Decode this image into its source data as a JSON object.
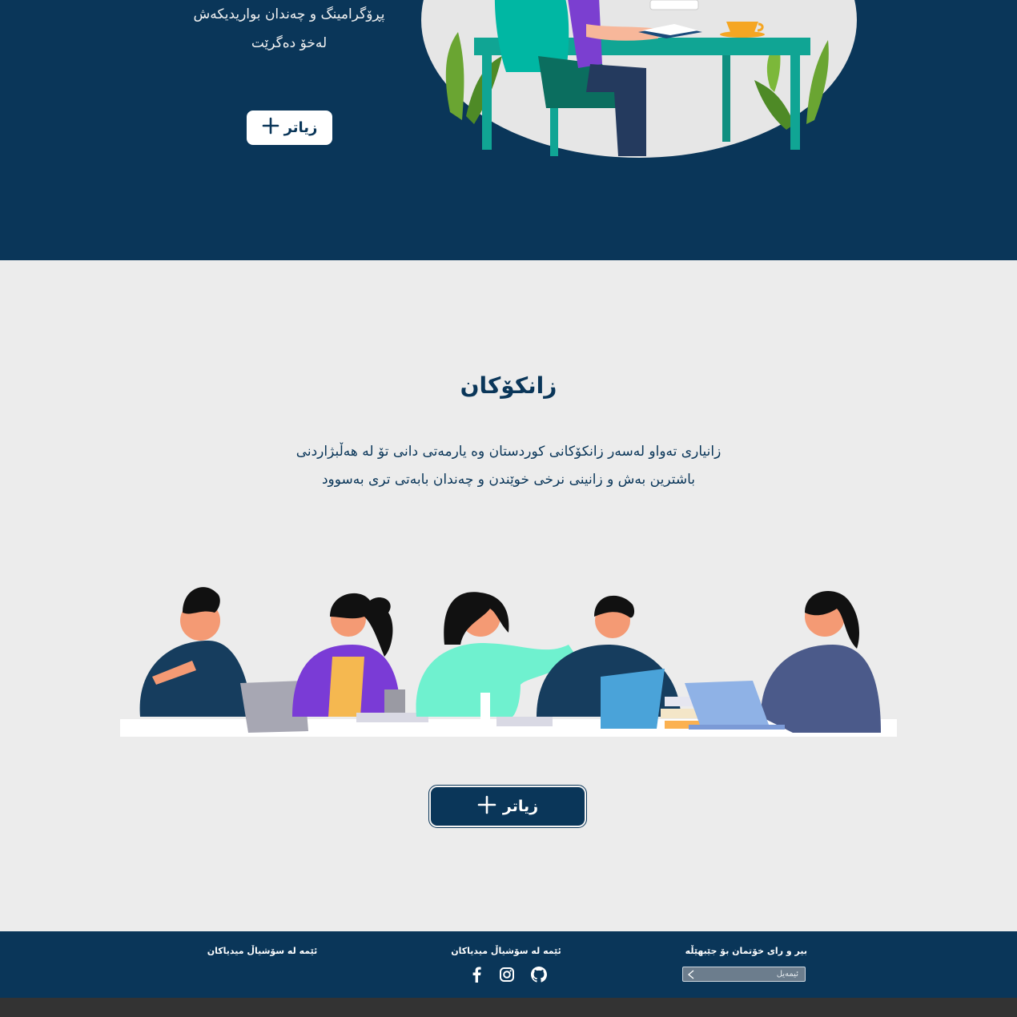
{
  "hero": {
    "line1": "پڕۆگرامینگ و چەندان بواریدیکەش",
    "line2": "لەخۆ دەگرێت",
    "more_label": "زیاتر"
  },
  "universities": {
    "title": "زانکۆکان",
    "desc_line1": "زانیاری تەواو لەسەر زانکۆکانی کوردستان وە یارمەتی دانی تۆ لە هەڵبژاردنی",
    "desc_line2": "باشترین بەش و زانینی نرخی خوێندن و چەندان بابەتی تری بەسوود",
    "more_label": "زیاتر"
  },
  "footer": {
    "left_heading": "ئێمە لە سۆشیاڵ میدیاکان",
    "mid_heading": "ئێمە لە سۆشیاڵ میدیاکان",
    "right_heading": "بیر و رای خۆتمان بۆ جێبهێڵە",
    "email_placeholder": "ئیمەیل",
    "social_icons": [
      "facebook-icon",
      "instagram-icon",
      "github-icon"
    ]
  },
  "colors": {
    "primary": "#0a3659",
    "background": "#ececec",
    "footer_bottom": "#333333"
  }
}
